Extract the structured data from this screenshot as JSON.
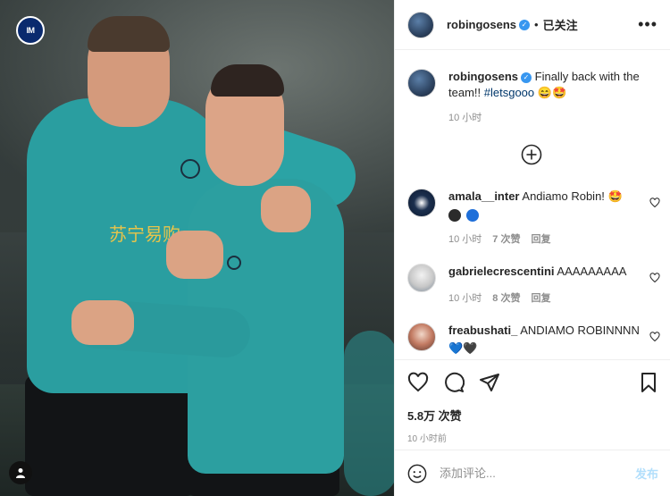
{
  "post": {
    "username": "robingosens",
    "verified_icon": "verified-badge-icon",
    "separator": "•",
    "follow_state": "已关注",
    "more_icon": "more-options-icon"
  },
  "caption": {
    "username": "robingosens",
    "text": "Finally back with the team!! ",
    "hashtag": "#letsgooo",
    "emojis": "😄🤩",
    "time": "10 小时"
  },
  "comments": [
    {
      "username": "amala__inter",
      "text": "Andiamo Robin! 🤩",
      "extra_emojis": [
        "black-circle",
        "blue-circle"
      ],
      "time": "10 小时",
      "likes": "7 次赞",
      "reply": "回复"
    },
    {
      "username": "gabrielecrescentini",
      "text": "AAAAAAAAA",
      "time": "10 小时",
      "likes": "8 次赞",
      "reply": "回复"
    },
    {
      "username": "freabushati_",
      "text": "ANDIAMO ROBINNNN",
      "extra_text": "💙🖤"
    }
  ],
  "actions": {
    "like_icon": "heart-icon",
    "comment_icon": "comment-icon",
    "share_icon": "share-icon",
    "save_icon": "bookmark-icon"
  },
  "likes_text": "5.8万 次赞",
  "post_time": "10 小时前",
  "add_comment": {
    "placeholder": "添加评论...",
    "post_label": "发布"
  },
  "photo": {
    "sponsor_text": "苏宁易购",
    "inter_logo_text": "IM"
  },
  "colors": {
    "verified": "#3897f0",
    "hashtag": "#00376b",
    "post_disabled": "#b2dffc",
    "meta_gray": "#8e8e8e",
    "jersey_teal": "#2a9ea0"
  }
}
